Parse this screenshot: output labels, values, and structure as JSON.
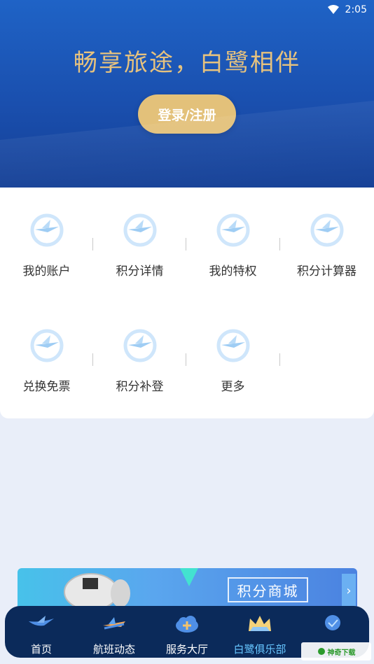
{
  "status_bar": {
    "time": "2:05"
  },
  "hero": {
    "slogan": "畅享旅途，白鹭相伴",
    "login_label": "登录/注册"
  },
  "menu": {
    "items": [
      {
        "label": "我的账户"
      },
      {
        "label": "积分详情"
      },
      {
        "label": "我的特权"
      },
      {
        "label": "积分计算器"
      },
      {
        "label": "兑换免票"
      },
      {
        "label": "积分补登"
      },
      {
        "label": "更多"
      }
    ]
  },
  "banner": {
    "title": "积分商城",
    "arrow": "›"
  },
  "tabbar": {
    "active_index": 3,
    "items": [
      {
        "label": "首页",
        "icon": "egret-logo-icon"
      },
      {
        "label": "航班动态",
        "icon": "airplane-icon"
      },
      {
        "label": "服务大厅",
        "icon": "cloud-plus-icon"
      },
      {
        "label": "白鹭俱乐部",
        "icon": "crown-icon"
      },
      {
        "label": "",
        "icon": "profile-icon"
      }
    ]
  },
  "watermark": {
    "text": "神奇下载"
  },
  "colors": {
    "accent_gold": "#e3c17a",
    "hero_blue": "#1a4fae",
    "tab_active": "#67c6ff"
  }
}
